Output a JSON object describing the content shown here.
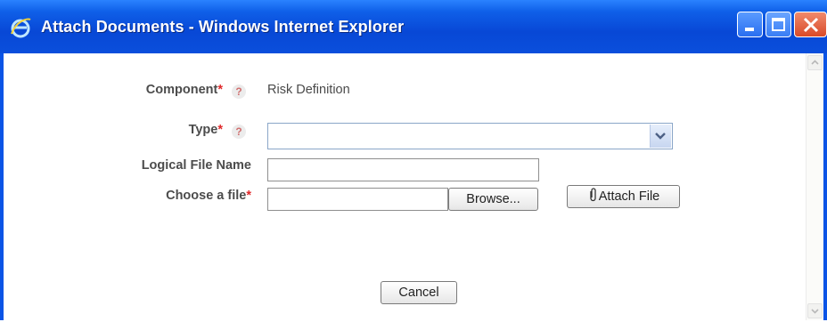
{
  "window": {
    "title": "Attach Documents - Windows Internet Explorer"
  },
  "form": {
    "component_label": "Component",
    "component_value": "Risk Definition",
    "type_label": "Type",
    "type_value": "",
    "logical_file_name_label": "Logical File Name",
    "logical_file_name_value": "",
    "choose_file_label": "Choose a file",
    "file_value": "",
    "required_marker": "*",
    "help_glyph": "?"
  },
  "buttons": {
    "browse": "Browse...",
    "attach": "Attach File",
    "cancel": "Cancel"
  },
  "icons": {
    "app": "internet-explorer-icon",
    "attach": "paperclip-icon"
  },
  "colors": {
    "titlebar": "#0a54e6",
    "required": "#e0282a",
    "close_button": "#d94a28"
  }
}
